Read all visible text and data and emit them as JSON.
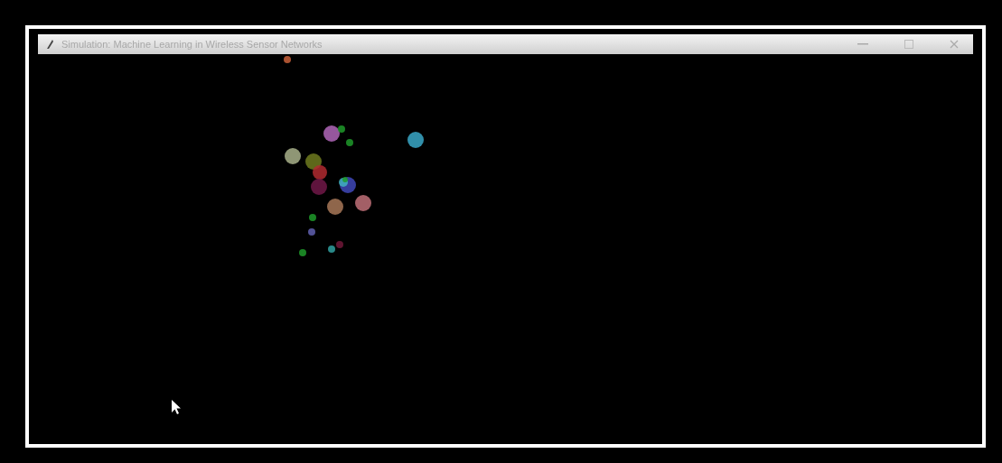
{
  "window": {
    "title": "Simulation: Machine Learning in Wireless Sensor Networks"
  }
}
